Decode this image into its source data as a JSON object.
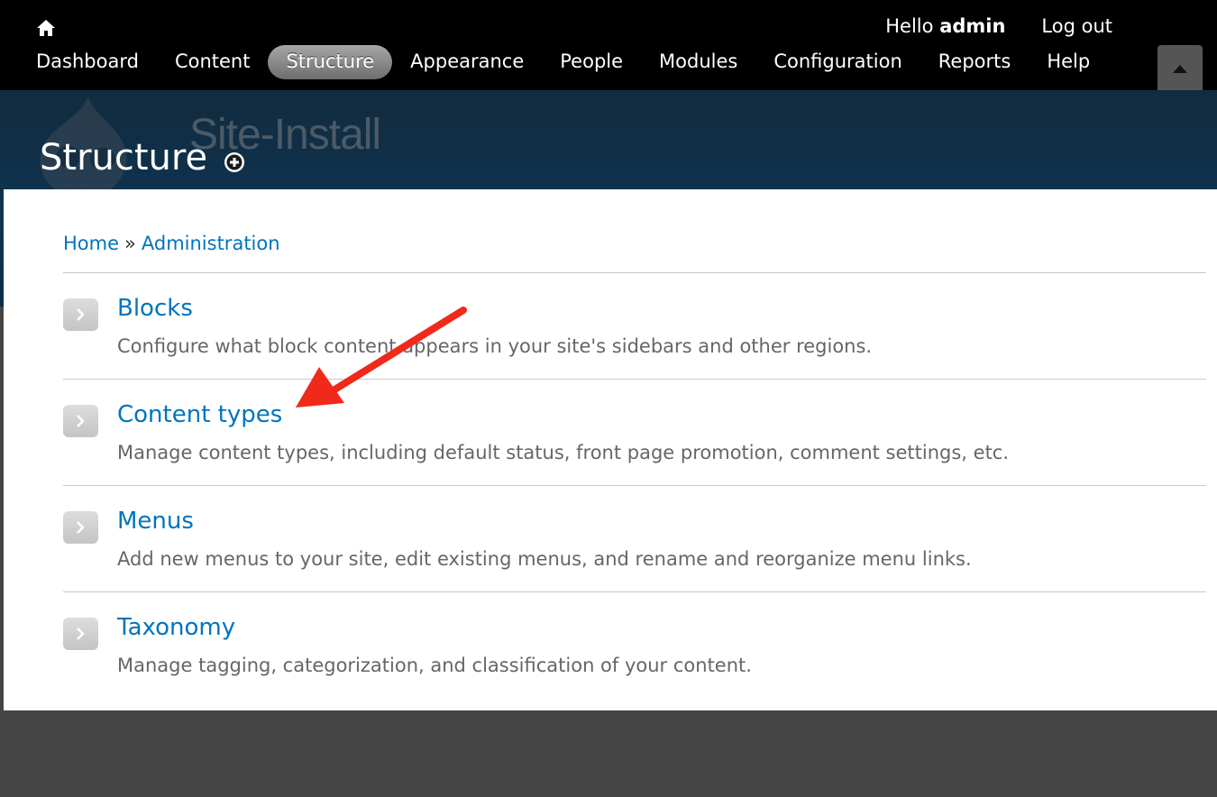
{
  "toolbar": {
    "home_icon": "home-icon",
    "greeting_prefix": "Hello",
    "username": "admin",
    "logout_label": "Log out",
    "menu": [
      {
        "label": "Dashboard"
      },
      {
        "label": "Content"
      },
      {
        "label": "Structure",
        "active": true
      },
      {
        "label": "Appearance"
      },
      {
        "label": "People"
      },
      {
        "label": "Modules"
      },
      {
        "label": "Configuration"
      },
      {
        "label": "Reports"
      },
      {
        "label": "Help"
      }
    ],
    "drawer_toggle_icon": "triangle-up-icon"
  },
  "branding": {
    "site_name": "Site-Install",
    "page_title": "Structure",
    "add_shortcut_icon": "plus-circle-icon"
  },
  "breadcrumb": {
    "items": [
      "Home",
      "Administration"
    ],
    "separator": "»"
  },
  "admin_list": [
    {
      "title": "Blocks",
      "description": "Configure what block content appears in your site's sidebars and other regions."
    },
    {
      "title": "Content types",
      "description": "Manage content types, including default status, front page promotion, comment settings, etc."
    },
    {
      "title": "Menus",
      "description": "Add new menus to your site, edit existing menus, and rename and reorganize menu links."
    },
    {
      "title": "Taxonomy",
      "description": "Manage tagging, categorization, and classification of your content."
    }
  ],
  "colors": {
    "toolbar_bg": "#000000",
    "link": "#0074bd",
    "annotation_arrow": "#f0291a",
    "page_bg": "#444444"
  }
}
